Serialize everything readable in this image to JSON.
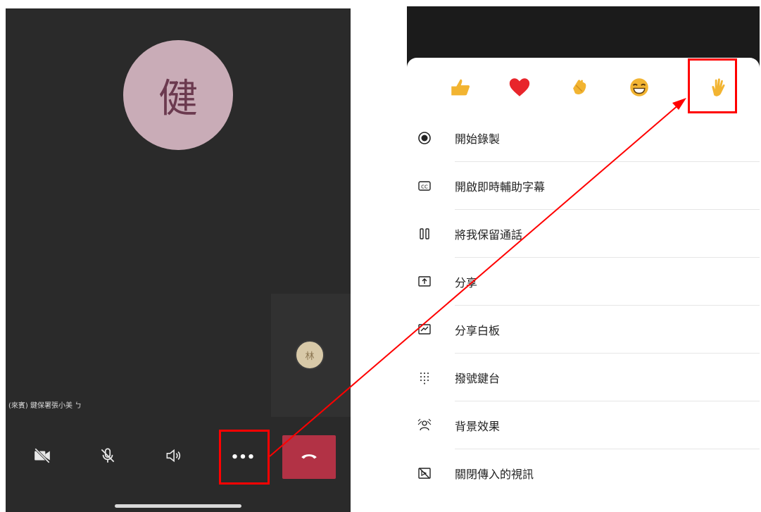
{
  "call": {
    "avatar_initial": "健",
    "self_initial": "林",
    "participant_name": "(來賓) 鍵保署張小美 ㄅ",
    "controls": [
      {
        "id": "camera",
        "icon": "video-off-icon"
      },
      {
        "id": "mic",
        "icon": "mic-off-icon"
      },
      {
        "id": "speaker",
        "icon": "speaker-icon"
      },
      {
        "id": "more",
        "label": "•••"
      },
      {
        "id": "hangup",
        "icon": "phone-hangup-icon"
      }
    ]
  },
  "menu": {
    "reactions": [
      "like-icon",
      "heart-icon",
      "applause-icon",
      "laugh-icon",
      "raise-hand-icon"
    ],
    "items": [
      {
        "label": "開始錄製",
        "icon": "record-icon"
      },
      {
        "label": "開啟即時輔助字幕",
        "icon": "closed-caption-icon"
      },
      {
        "label": "將我保留通話",
        "icon": "pause-icon"
      },
      {
        "label": "分享",
        "icon": "share-icon"
      },
      {
        "label": "分享白板",
        "icon": "whiteboard-icon"
      },
      {
        "label": "撥號鍵台",
        "icon": "dialpad-icon"
      },
      {
        "label": "背景效果",
        "icon": "background-effects-icon"
      },
      {
        "label": "關閉傳入的視訊",
        "icon": "video-off-icon"
      }
    ]
  },
  "colors": {
    "annotation": "#ff0000",
    "hangup": "#b23245",
    "call_background": "#2a2a2a",
    "avatar": "#c9acb7"
  }
}
